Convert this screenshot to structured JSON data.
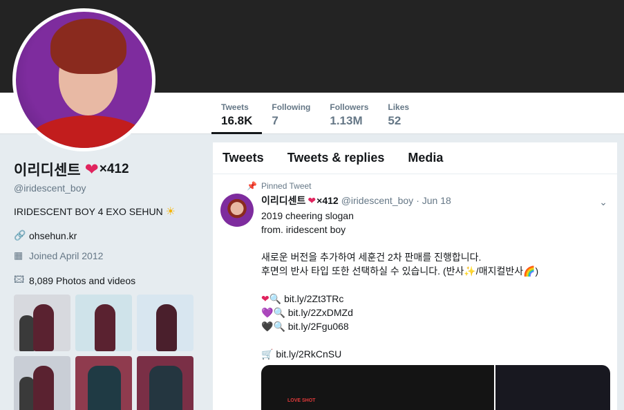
{
  "stats": [
    {
      "label": "Tweets",
      "value": "16.8K"
    },
    {
      "label": "Following",
      "value": "7"
    },
    {
      "label": "Followers",
      "value": "1.13M"
    },
    {
      "label": "Likes",
      "value": "52"
    }
  ],
  "profile": {
    "name": "이리디센트",
    "heart": "❤",
    "mult": "×412",
    "handle": "@iridescent_boy",
    "bio": "IRIDESCENT BOY 4 EXO SEHUN",
    "bio_emoji": "☀",
    "link": "ohsehun.kr",
    "joined": "Joined April 2012",
    "photos_label": "8,089 Photos and videos"
  },
  "icons": {
    "link": "🔗",
    "calendar": "▦",
    "photos": "🖾",
    "pin": "📌",
    "chevron": "⌄"
  },
  "tabs": [
    "Tweets",
    "Tweets & replies",
    "Media"
  ],
  "tweet": {
    "pinned": "Pinned Tweet",
    "name": "이리디센트",
    "heart": "❤",
    "mult": "×412",
    "handle": "@iridescent_boy",
    "date": "· Jun 18",
    "lines": [
      "2019 cheering slogan",
      "from. iridescent boy",
      "",
      "새로운 버전을 추가하여 세훈건 2차 판매를 진행합니다.",
      "후면의 반사 타입 또한 선택하실 수 있습니다. (반사✨/매지컬반사🌈)",
      ""
    ],
    "links": [
      {
        "emoji": "❤",
        "mag": "🔍",
        "url": "bit.ly/2Zt3TRc"
      },
      {
        "emoji": "💜",
        "mag": "🔍",
        "url": "bit.ly/2ZxDMZd"
      },
      {
        "emoji": "🖤",
        "mag": "🔍",
        "url": "bit.ly/2Fgu068"
      }
    ],
    "cart": "🛒",
    "cart_url": "bit.ly/2RkCnSU",
    "media_text": "LOVE SHOT"
  },
  "colors": {
    "accent": "#1da1f2",
    "heart": "#e0245e",
    "banner": "#232323"
  }
}
